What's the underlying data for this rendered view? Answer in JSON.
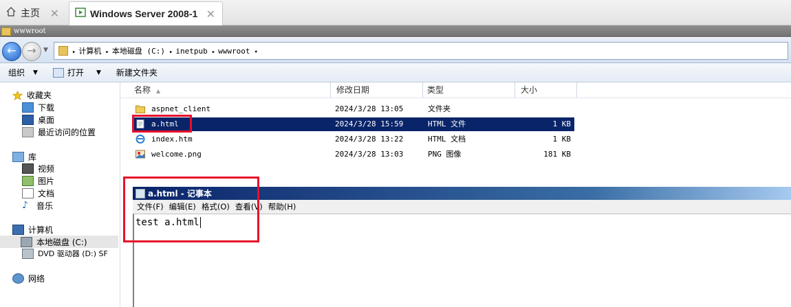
{
  "tabs": [
    {
      "label": "主页",
      "icon": "home-icon"
    },
    {
      "label": "Windows Server 2008-1",
      "icon": "vm-icon",
      "active": true
    }
  ],
  "window": {
    "title": "wwwroot"
  },
  "address": {
    "crumbs": [
      "计算机",
      "本地磁盘 (C:)",
      "inetpub",
      "wwwroot"
    ]
  },
  "toolbar": {
    "organize_label": "组织",
    "open_label": "打开",
    "new_folder_label": "新建文件夹"
  },
  "nav": {
    "favorites": {
      "label": "收藏夹",
      "items": [
        "下载",
        "桌面",
        "最近访问的位置"
      ]
    },
    "libraries": {
      "label": "库",
      "items": [
        "视频",
        "图片",
        "文档",
        "音乐"
      ]
    },
    "computer": {
      "label": "计算机",
      "items": [
        "本地磁盘 (C:)",
        "DVD 驱动器 (D:) SF"
      ]
    },
    "network": {
      "label": "网络"
    }
  },
  "columns": {
    "name": "名称",
    "modified": "修改日期",
    "type": "类型",
    "size": "大小"
  },
  "files": [
    {
      "name": "aspnet_client",
      "modified": "2024/3/28 13:05",
      "type": "文件夹",
      "size": "",
      "icon": "folder-icon"
    },
    {
      "name": "a.html",
      "modified": "2024/3/28 15:59",
      "type": "HTML 文件",
      "size": "1 KB",
      "icon": "html-file-icon",
      "selected": true
    },
    {
      "name": "index.htm",
      "modified": "2024/3/28 13:22",
      "type": "HTML 文档",
      "size": "1 KB",
      "icon": "ie-document-icon"
    },
    {
      "name": "welcome.png",
      "modified": "2024/3/28 13:03",
      "type": "PNG 图像",
      "size": "181 KB",
      "icon": "image-file-icon"
    }
  ],
  "notepad": {
    "title": "a.html - 记事本",
    "menu": [
      "文件(F)",
      "编辑(E)",
      "格式(O)",
      "查看(V)",
      "帮助(H)"
    ],
    "content": "test a.html"
  },
  "colors": {
    "selection": "#0a246a",
    "annotation": "#e8102b",
    "notepad_title": "#0a246a"
  }
}
